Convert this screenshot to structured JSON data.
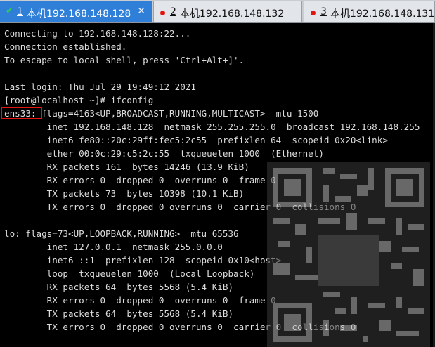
{
  "tabs": [
    {
      "index": "1",
      "title": "本机192.168.148.128",
      "active": true,
      "status_color": "#2ed04b",
      "close_icon": "close-icon"
    },
    {
      "index": "2",
      "title": "本机192.168.148.132",
      "active": false,
      "status_color": "#e3150f"
    },
    {
      "index": "3",
      "title": "本机192.168.148.131",
      "active": false,
      "status_color": "#e3150f"
    }
  ],
  "terminal": {
    "lines": [
      "Connecting to 192.168.148.128:22...",
      "Connection established.",
      "To escape to local shell, press 'Ctrl+Alt+]'.",
      "",
      "Last login: Thu Jul 29 19:49:12 2021",
      "[root@localhost ~]# ifconfig",
      "ens33: flags=4163<UP,BROADCAST,RUNNING,MULTICAST>  mtu 1500",
      "        inet 192.168.148.128  netmask 255.255.255.0  broadcast 192.168.148.255",
      "        inet6 fe80::20c:29ff:fec5:2c55  prefixlen 64  scopeid 0x20<link>",
      "        ether 00:0c:29:c5:2c:55  txqueuelen 1000  (Ethernet)",
      "        RX packets 161  bytes 14246 (13.9 KiB)",
      "        RX errors 0  dropped 0  overruns 0  frame 0",
      "        TX packets 73  bytes 10398 (10.1 KiB)",
      "        TX errors 0  dropped 0 overruns 0  carrier 0  collisions 0",
      "",
      "lo: flags=73<UP,LOOPBACK,RUNNING>  mtu 65536",
      "        inet 127.0.0.1  netmask 255.0.0.0",
      "        inet6 ::1  prefixlen 128  scopeid 0x10<host>",
      "        loop  txqueuelen 1000  (Local Loopback)",
      "        RX packets 64  bytes 5568 (5.4 KiB)",
      "        RX errors 0  dropped 0  overruns 0  frame 0",
      "        TX packets 64  bytes 5568 (5.4 KiB)",
      "        TX errors 0  dropped 0 overruns 0  carrier 0  collisions 0"
    ],
    "highlight_color": "#e3150f",
    "text_color": "#dcdcdc"
  },
  "watermark": {
    "type": "qr-code"
  }
}
